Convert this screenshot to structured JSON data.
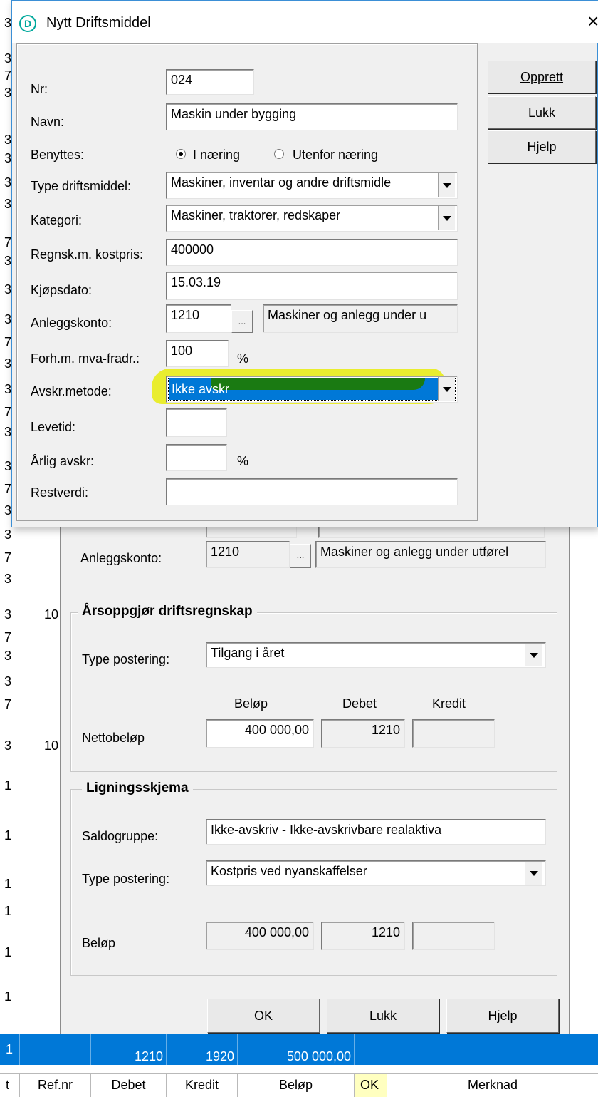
{
  "background": {
    "left_digits": [
      "3",
      "3",
      "7",
      "3",
      "3",
      "3",
      "3",
      "3",
      "7",
      "3",
      "3",
      "3",
      "7",
      "3",
      "3",
      "7",
      "3",
      "3",
      "7",
      "3",
      "3",
      "7",
      "3",
      "3",
      "7",
      "3",
      "3",
      "7",
      "3",
      "1",
      "1",
      "1",
      "1",
      "1",
      "1"
    ],
    "left_digits_10": [
      "10",
      "10"
    ]
  },
  "dialog": {
    "title": "Nytt Driftsmiddel",
    "close_glyph": "×",
    "buttons": {
      "create": "Opprett",
      "close": "Lukk",
      "help": "Hjelp"
    },
    "fields": {
      "nr_label": "Nr:",
      "nr_value": "024",
      "navn_label": "Navn:",
      "navn_value": "Maskin under bygging",
      "benyttes_label": "Benyttes:",
      "radio_naering": "I næring",
      "radio_utenfor": "Utenfor næring",
      "type_label": "Type driftsmiddel:",
      "type_value": "Maskiner, inventar og andre driftsmidle",
      "kategori_label": "Kategori:",
      "kategori_value": "Maskiner, traktorer, redskaper",
      "kostpris_label": "Regnsk.m. kostpris:",
      "kostpris_value": "400000",
      "kjopsdato_label": "Kjøpsdato:",
      "kjopsdato_value": "15.03.19",
      "anleggskonto_label": "Anleggskonto:",
      "anleggskonto_value": "1210",
      "anleggskonto_desc": "Maskiner og anlegg under u",
      "mva_label": "Forh.m. mva-fradr.:",
      "mva_value": "100",
      "mva_unit": "%",
      "avskr_label": "Avskr.metode:",
      "avskr_value": "Ikke avskr",
      "levetid_label": "Levetid:",
      "arlig_label": "Årlig avskr:",
      "arlig_unit": "%",
      "restverdi_label": "Restverdi:"
    }
  },
  "back_dialog": {
    "anleggskonto_label": "Anleggskonto:",
    "anleggskonto_value": "1210",
    "anleggskonto_desc": "Maskiner og anlegg under utførel",
    "group1_title": "Årsoppgjør driftsregnskap",
    "type_postering_label": "Type postering:",
    "type_postering_value": "Tilgang i året",
    "col_belop": "Beløp",
    "col_debet": "Debet",
    "col_kredit": "Kredit",
    "nettobelop_label": "Nettobeløp",
    "nettobelop_value": "400 000,00",
    "nettobelop_debet": "1210",
    "group2_title": "Ligningsskjema",
    "saldogruppe_label": "Saldogruppe:",
    "saldogruppe_value": "Ikke-avskriv - Ikke-avskrivbare realaktiva",
    "type_postering2_label": "Type postering:",
    "type_postering2_value": "Kostpris ved nyanskaffelser",
    "belop_label": "Beløp",
    "belop_value": "400 000,00",
    "belop_debet": "1210",
    "ok": "OK",
    "lukk": "Lukk",
    "hjelp": "Hjelp"
  },
  "grid": {
    "selected_row": {
      "marker": "1",
      "debet": "1210",
      "kredit": "1920",
      "belop": "500 000,00"
    },
    "headers": {
      "t": "t",
      "ref": "Ref.nr",
      "debet": "Debet",
      "kredit": "Kredit",
      "belop": "Beløp",
      "ok": "OK",
      "merknad": "Merknad"
    },
    "row": {
      "marker": "1",
      "debet": "1210",
      "kredit": "1920",
      "belop": "500 000,00"
    },
    "colors": {
      "selection": "#0078d7",
      "ok_header": "#ffffc0"
    }
  },
  "colors": {
    "highlighter": "#e8ec1a",
    "dialog_bg": "#f0f0f0",
    "title_bg": "#ffffff",
    "dialog_border": "#3b8fd6",
    "icon": "#00a89c"
  },
  "icons": {
    "app_icon": "D",
    "ellipsis": "..."
  }
}
